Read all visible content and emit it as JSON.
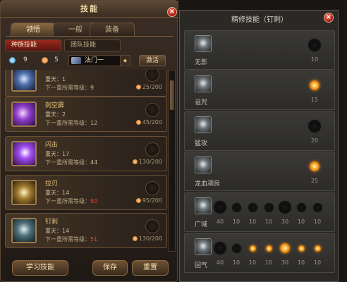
{
  "left_panel": {
    "title": "技能",
    "close_icon": "×",
    "tabs": [
      {
        "label": "领悟",
        "active": true
      },
      {
        "label": "一般",
        "active": false
      },
      {
        "label": "装备",
        "active": false
      }
    ],
    "subtabs": [
      {
        "label": "种族技能",
        "active": true
      },
      {
        "label": "团队技能",
        "active": false
      }
    ],
    "points": {
      "blue": "9",
      "orange": "5"
    },
    "school_select": {
      "value": "法门一",
      "arrow": "◆"
    },
    "activate_label": "激活",
    "skills": [
      {
        "name": "",
        "level": "重天：1",
        "req_label": "下一重所需等级：",
        "req_value": "9",
        "req_red": false,
        "cost": "25/200",
        "icon": "blue"
      },
      {
        "name": "刺空霹",
        "level": "重天：2",
        "req_label": "下一重所需等级：",
        "req_value": "12",
        "req_red": false,
        "cost": "45/200",
        "icon": "purple"
      },
      {
        "name": "闪击",
        "level": "重天：17",
        "req_label": "下一重所需等级：",
        "req_value": "44",
        "req_red": false,
        "cost": "130/200",
        "icon": "purple2"
      },
      {
        "name": "拉刃",
        "level": "重天：14",
        "req_label": "下一重所需等级：",
        "req_value": "50",
        "req_red": true,
        "cost": "95/200",
        "icon": "gold"
      },
      {
        "name": "钉刺",
        "level": "重天：14",
        "req_label": "下一重所需等级：",
        "req_value": "51",
        "req_red": true,
        "cost": "130/200",
        "icon": "steel"
      }
    ],
    "buttons": {
      "learn": "学习技能",
      "save": "保存",
      "reset": "重置"
    }
  },
  "right_panel": {
    "title": "精修技能（钉刺）",
    "close_icon": "×",
    "rows": [
      {
        "name": "无影",
        "stars": [
          {
            "lit": false,
            "big": true,
            "value": "10"
          }
        ]
      },
      {
        "name": "诅咒",
        "stars": [
          {
            "lit": true,
            "big": true,
            "value": "15"
          }
        ]
      },
      {
        "name": "猛攻",
        "stars": [
          {
            "lit": false,
            "big": true,
            "value": "20"
          }
        ]
      },
      {
        "name": "龙血凋良",
        "stars": [
          {
            "lit": true,
            "big": true,
            "value": "25"
          }
        ]
      },
      {
        "name": "广域",
        "stars": [
          {
            "lit": false,
            "big": true,
            "value": "40"
          },
          {
            "lit": false,
            "big": false,
            "value": "10"
          },
          {
            "lit": false,
            "big": false,
            "value": "10"
          },
          {
            "lit": false,
            "big": false,
            "value": "10"
          },
          {
            "lit": false,
            "big": true,
            "value": "30"
          },
          {
            "lit": false,
            "big": false,
            "value": "10"
          },
          {
            "lit": false,
            "big": false,
            "value": "10"
          }
        ]
      },
      {
        "name": "回气",
        "stars": [
          {
            "lit": false,
            "big": true,
            "value": "40"
          },
          {
            "lit": false,
            "big": false,
            "value": "10"
          },
          {
            "lit": true,
            "big": false,
            "value": "10"
          },
          {
            "lit": true,
            "big": false,
            "value": "10"
          },
          {
            "lit": true,
            "big": true,
            "value": "30"
          },
          {
            "lit": true,
            "big": false,
            "value": "10"
          },
          {
            "lit": true,
            "big": false,
            "value": "10"
          }
        ]
      }
    ]
  }
}
